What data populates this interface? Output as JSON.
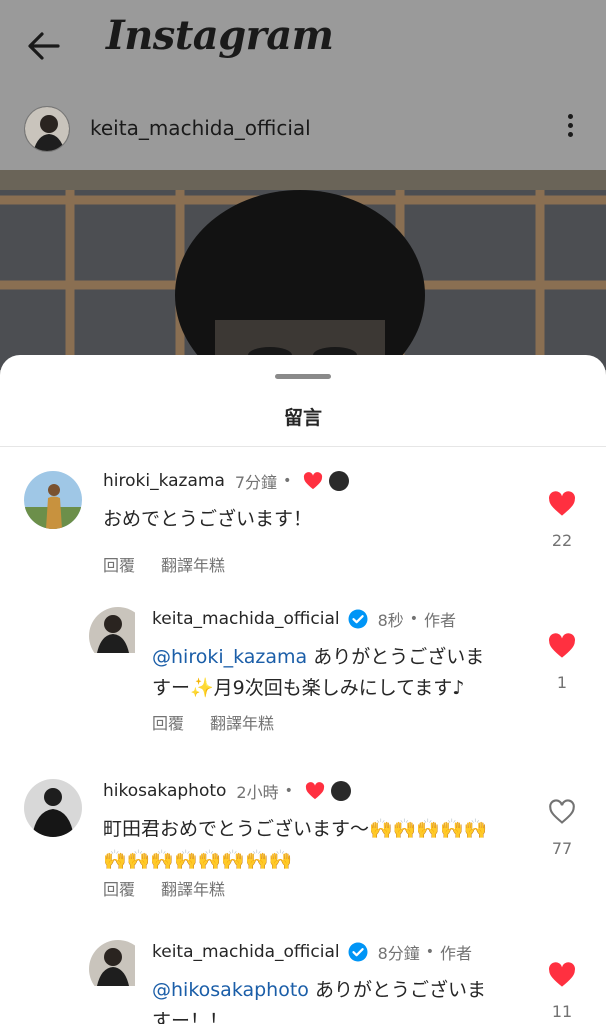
{
  "header": {
    "app_title": "Instagram",
    "post_username": "keita_machida_official"
  },
  "sheet": {
    "title": "留言"
  },
  "comments": [
    {
      "username": "hiroki_kazama",
      "time": "7分鐘",
      "text": "おめでとうございます！",
      "reply_label": "回覆",
      "translate_label": "翻譯年糕",
      "likes": "22",
      "liked": true,
      "creator_liked": true
    },
    {
      "username": "keita_machida_official",
      "time": "8秒",
      "author_label": "作者",
      "mention": "@hiroki_kazama",
      "text_after_mention": " ありがとうございま",
      "text_line2": "すー✨月9次回も楽しみにしてます♪",
      "reply_label": "回覆",
      "translate_label": "翻譯年糕",
      "likes": "1",
      "liked": true
    },
    {
      "username": "hikosakaphoto",
      "time": "2小時",
      "text_line1": "町田君おめでとうございます〜🙌🙌🙌🙌🙌",
      "text_line2": "🙌🙌🙌🙌🙌🙌🙌🙌",
      "reply_label": "回覆",
      "translate_label": "翻譯年糕",
      "likes": "77",
      "liked": false,
      "creator_liked": true
    },
    {
      "username": "keita_machida_official",
      "time": "8分鐘",
      "author_label": "作者",
      "mention": "@hikosakaphoto",
      "text_after_mention": " ありがとうございま",
      "text_line2": "すー！！",
      "likes": "11",
      "liked": true
    }
  ],
  "colors": {
    "like_red": "#ff3040",
    "mention_blue": "#1b5ea8",
    "verified_blue": "#0095f6",
    "secondary_text": "#737373"
  },
  "icons": [
    "back-arrow-icon",
    "more-options-icon",
    "heart-icon",
    "verified-badge-icon"
  ]
}
